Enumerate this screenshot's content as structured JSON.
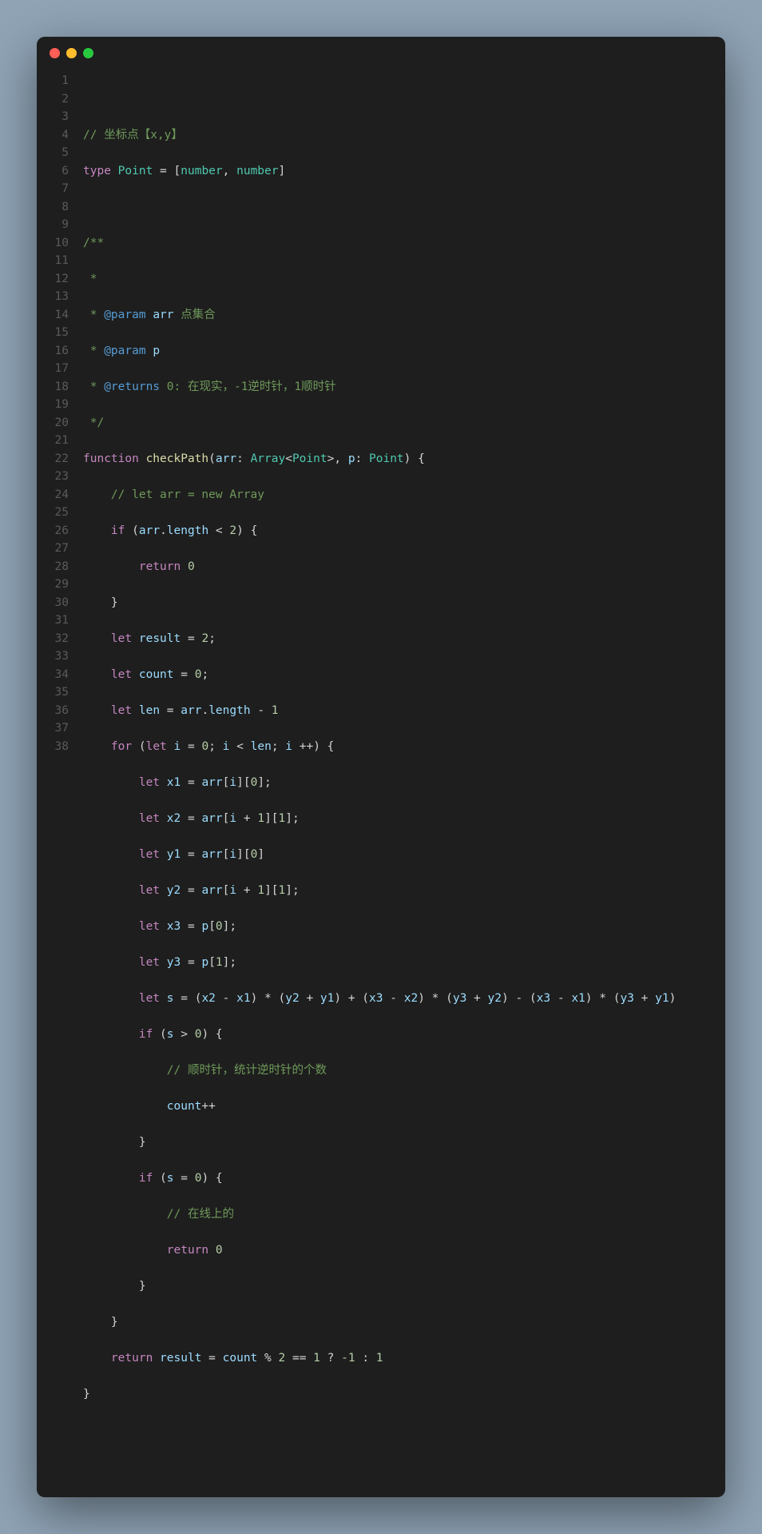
{
  "window": {
    "dots": [
      "red",
      "yellow",
      "green"
    ]
  },
  "code": {
    "line2_comment": "// 坐标点【x,y】",
    "kw_type": "type",
    "type_Point": "Point",
    "eq": " = ",
    "lbracket": "[",
    "number_t": "number",
    "comma_sp": ", ",
    "rbracket": "]",
    "doc_open": "/**",
    "doc_star": " *",
    "doc_param": "@param",
    "doc_returns": "@returns",
    "doc_arr": " arr",
    "doc_arr_desc": " 点集合",
    "doc_p": " p",
    "doc_ret_desc": " 0: 在现实，-1逆时针，1顺时针",
    "doc_close": " */",
    "kw_function": "function",
    "fn_checkPath": "checkPath",
    "p_arr": "arr",
    "t_Array": "Array",
    "p_p": "p",
    "cm_let_arr": "// let arr = new Array",
    "kw_if": "if",
    "kw_return": "return",
    "kw_let": "let",
    "kw_for": "for",
    "id_length": "length",
    "id_result": "result",
    "id_count": "count",
    "id_len": "len",
    "id_i": "i",
    "id_x1": "x1",
    "id_x2": "x2",
    "id_y1": "y1",
    "id_y2": "y2",
    "id_x3": "x3",
    "id_y3": "y3",
    "id_s": "s",
    "n0": "0",
    "n1": "1",
    "n2": "2",
    "n_neg1": "-1",
    "cm_clockwise": "// 顺时针，统计逆时针的个数",
    "cm_online": "// 在线上的"
  }
}
